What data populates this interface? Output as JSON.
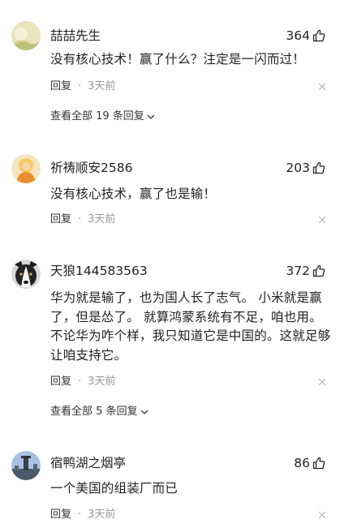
{
  "comments": [
    {
      "username": "喆喆先生",
      "likes": "364",
      "text": "没有核心技术！赢了什么？注定是一闪而过！",
      "reply": "回复",
      "dot": "·",
      "time": "3天前",
      "view_replies": "查看全部 19 条回复",
      "avatar_colors": [
        "#e8dcb0",
        "#b8c37a"
      ]
    },
    {
      "username": "祈祷顺安2586",
      "likes": "203",
      "text": "没有核心技术，赢了也是输！",
      "reply": "回复",
      "dot": "·",
      "time": "3天前",
      "avatar_colors": [
        "#f2d28a",
        "#e89a3a"
      ]
    },
    {
      "username": "天狼144583563",
      "likes": "372",
      "text": "华为就是输了，也为国人长了志气。 小米就是赢了，但是怂了。 就算鸿蒙系统有不足，咱也用。不论华为咋个样，我只知道它是中国的。这就足够让咱支持它。",
      "reply": "回复",
      "dot": "·",
      "time": "3天前",
      "view_replies": "查看全部 5 条回复",
      "avatar_colors": [
        "#2b2b2b",
        "#f2f2f2"
      ]
    },
    {
      "username": "宿鸭湖之烟亭",
      "likes": "86",
      "text": "一个美国的组装厂而已",
      "reply": "回复",
      "dot": "·",
      "time": "3天前",
      "avatar_colors": [
        "#9cb4d8",
        "#3a4a5a"
      ]
    }
  ],
  "icons": {
    "like": "thumbs-up-icon",
    "close": "close-icon",
    "expand": "chevron-down-icon"
  }
}
